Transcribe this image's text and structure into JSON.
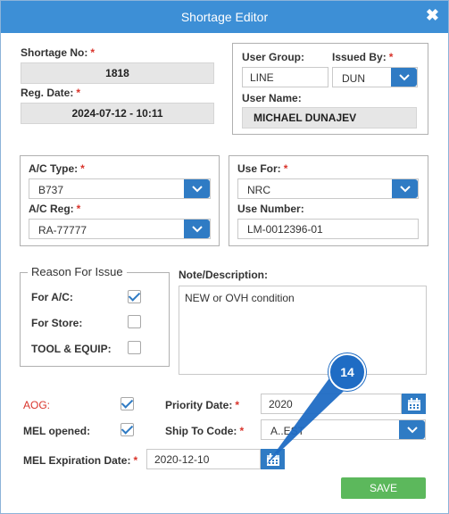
{
  "dialog": {
    "title": "Shortage Editor",
    "close_icon": "✖"
  },
  "shortage": {
    "no_label": "Shortage No:",
    "no_value": "1818",
    "reg_label": "Reg. Date:",
    "reg_value": "2024-07-12 - 10:11"
  },
  "user": {
    "group_label": "User Group:",
    "group_value": "LINE",
    "issued_label": "Issued By:",
    "issued_value": "DUN",
    "name_label": "User Name:",
    "name_value": "MICHAEL DUNAJEV"
  },
  "aircraft": {
    "type_label": "A/C Type:",
    "type_value": "B737",
    "reg_label": "A/C Reg:",
    "reg_value": "RA-77777"
  },
  "use": {
    "for_label": "Use For:",
    "for_value": "NRC",
    "number_label": "Use Number:",
    "number_value": "LM-0012396-01"
  },
  "reason": {
    "legend": "Reason For Issue",
    "ac_label": "For A/C:",
    "ac_checked": true,
    "store_label": "For Store:",
    "store_checked": false,
    "tool_label": "TOOL & EQUIP:",
    "tool_checked": false
  },
  "note": {
    "label": "Note/Description:",
    "value": "NEW or OVH condition"
  },
  "flags": {
    "aog_label": "AOG:",
    "aog_checked": true,
    "aog_color": "#d9342b",
    "mel_label": "MEL opened:",
    "mel_checked": true
  },
  "priority": {
    "label": "Priority Date:",
    "value": "2020"
  },
  "ship": {
    "label": "Ship To Code:",
    "value": "A..EST"
  },
  "mel_exp": {
    "label": "MEL Expiration Date:",
    "value": "2020-12-10"
  },
  "save_label": "SAVE",
  "annotation": {
    "number": "14",
    "color": "#1f6cc4"
  },
  "colors": {
    "accent": "#2f7bc4",
    "title_bar": "#3d8fd6",
    "save": "#5cb85c",
    "required": "#d9342b"
  },
  "icons": {
    "dropdown": "chevron-down-icon",
    "calendar": "calendar-icon",
    "close": "close-icon",
    "check": "check-icon"
  }
}
